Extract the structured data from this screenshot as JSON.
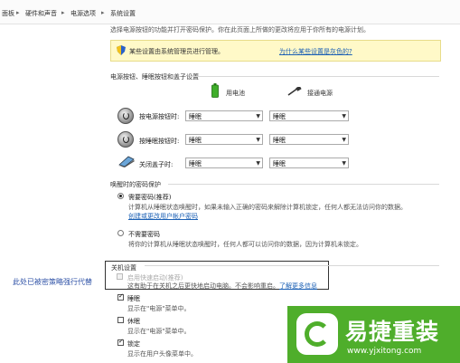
{
  "breadcrumb": {
    "items": [
      "面板",
      "硬件和声音",
      "电源选项",
      "系统设置"
    ],
    "separator": "▸"
  },
  "intro_text": "选择电源按钮的功能并打开密码保护。你在此页面上所做的更改将应用于你所有的电源计划。",
  "notice": {
    "text": "某些设置由系统管理员进行管理。",
    "link": "为什么某些设置是灰色的?"
  },
  "power_buttons": {
    "title": "电源按钮、睡眠按钮和盖子设置",
    "col_battery": "用电池",
    "col_plugged": "接通电源",
    "rows": [
      {
        "label": "按电源按钮时:",
        "battery": "睡眠",
        "plugged": "睡眠",
        "icon": "power-button-icon"
      },
      {
        "label": "按睡眠按钮时:",
        "battery": "睡眠",
        "plugged": "睡眠",
        "icon": "sleep-button-icon"
      },
      {
        "label": "关闭盖子时:",
        "battery": "睡眠",
        "plugged": "睡眠",
        "icon": "laptop-lid-icon"
      }
    ]
  },
  "wake_password": {
    "title": "唤醒时的密码保护",
    "option_require": "需要密码(推荐)",
    "require_desc": "计算机从睡眠状态唤醒时，如果未输入正确的密码来解除计算机锁定，任何人都无法访问你的数据。",
    "create_link": "创建或更改用户帐户密码",
    "option_no": "不需要密码",
    "no_desc": "将你的计算机从睡眠状态唤醒时，任何人都可以访问你的数据，因为计算机未锁定。"
  },
  "shutdown": {
    "title": "关机设置",
    "fast_startup": "启用快速启动(推荐)",
    "fast_startup_desc": "这有助于在关机之后更快地启动电脑。不会影响重启。",
    "fast_startup_link": "了解更多信息",
    "sleep": "睡眠",
    "sleep_desc": "显示在\"电源\"菜单中。",
    "hibernate": "休眠",
    "hibernate_desc": "显示在\"电源\"菜单中。",
    "lock": "锁定",
    "lock_desc": "显示在用户头像菜单中。"
  },
  "annotation": "此处已被密策略强行代替",
  "watermark": {
    "name": "易捷重装",
    "url": "www.yjxitong.com"
  },
  "colors": {
    "link": "#1a5fb4",
    "notice_bg": "#fff9c8",
    "watermark_green": "#4fae2b",
    "annotation": "#2e51a6"
  }
}
